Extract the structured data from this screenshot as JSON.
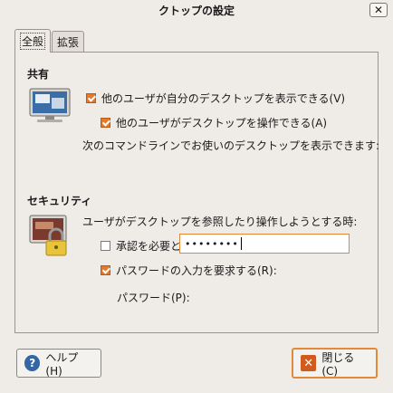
{
  "window": {
    "title": "クトップの設定",
    "close_symbol": "✕"
  },
  "tabs": [
    {
      "label": "全般",
      "active": true
    },
    {
      "label": "拡張",
      "active": false
    }
  ],
  "sharing": {
    "title": "共有",
    "allow_view_label": "他のユーザが自分のデスクトップを表示できる(V)",
    "allow_view_checked": true,
    "allow_control_label": "他のユーザがデスクトップを操作できる(A)",
    "allow_control_checked": true,
    "command_line_text": "次のコマンドラインでお使いのデスクトップを表示できます:"
  },
  "security": {
    "title": "セキュリティ",
    "when_text": "ユーザがデスクトップを参照したり操作しようとする時:",
    "confirm_label": "承認を必要とする(S)",
    "confirm_checked": false,
    "require_password_label": "パスワードの入力を要求する(R):",
    "require_password_checked": true,
    "password_label": "パスワード(P):",
    "password_value": "••••••••"
  },
  "buttons": {
    "help_label": "ヘルプ(H)",
    "close_label": "閉じる(C)"
  },
  "colors": {
    "accent": "#e37a2b",
    "help_icon": "#3465a4"
  }
}
